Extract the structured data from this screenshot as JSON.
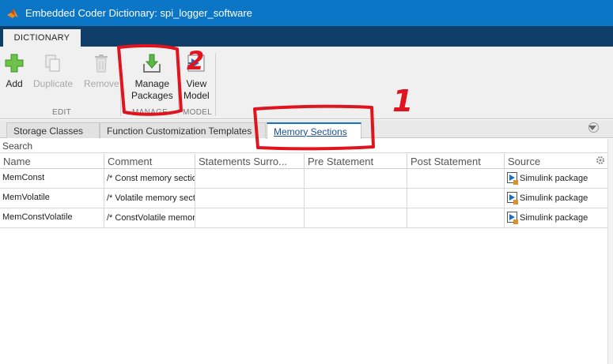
{
  "window": {
    "title": "Embedded Coder Dictionary: spi_logger_software"
  },
  "ribbon_tab": {
    "label": "DICTIONARY"
  },
  "toolstrip": {
    "add_label": "Add",
    "duplicate_label": "Duplicate",
    "remove_label": "Remove",
    "manage_label_1": "Manage",
    "manage_label_2": "Packages",
    "view_label_1": "View",
    "view_label_2": "Model",
    "section_edit": "EDIT",
    "section_manage": "MANAGE",
    "section_model": "MODEL"
  },
  "subtabs": {
    "storage_classes": "Storage Classes",
    "function_templates": "Function Customization Templates",
    "memory_sections": "Memory Sections"
  },
  "search": {
    "placeholder": "Search"
  },
  "table": {
    "headers": {
      "name": "Name",
      "comment": "Comment",
      "statements": "Statements Surro...",
      "pre": "Pre Statement",
      "post": "Post Statement",
      "source": "Source"
    },
    "rows": [
      {
        "name": "MemConst",
        "comment": "/* Const memory section */",
        "source": "Simulink package"
      },
      {
        "name": "MemVolatile",
        "comment": "/* Volatile memory section */",
        "source": "Simulink package"
      },
      {
        "name": "MemConstVolatile",
        "comment": "/* ConstVolatile memory section */",
        "source": "Simulink package"
      }
    ]
  },
  "annotations": {
    "one": "1",
    "two": "2"
  },
  "colors": {
    "titlebar": "#0b76c6",
    "tabstrip": "#0f3f68",
    "annotation": "#e0141e",
    "active_link": "#1a4fa0"
  }
}
